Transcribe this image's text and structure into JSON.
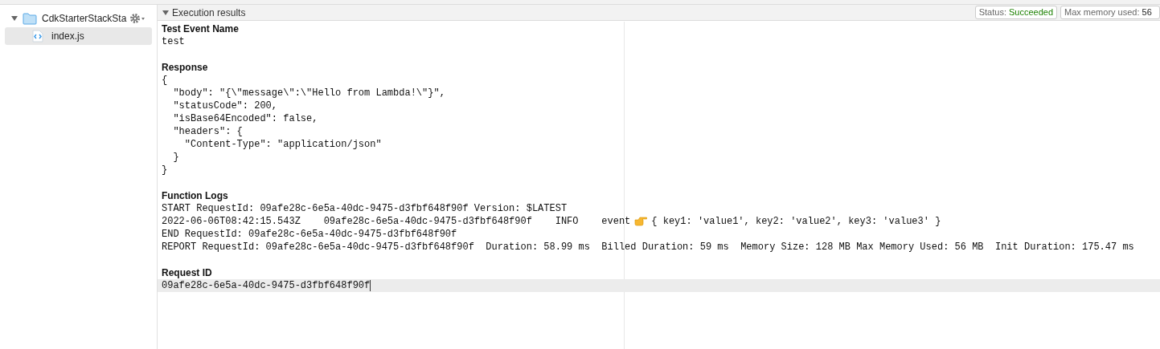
{
  "sidebar": {
    "folder": {
      "name": "CdkStarterStackSta",
      "expanded": true,
      "children": [
        {
          "name": "index.js",
          "selected": true
        }
      ]
    }
  },
  "panel": {
    "title": "Execution results",
    "expanded": true,
    "status_label": "Status:",
    "status_value": "Succeeded",
    "memory_label": "Max memory used:",
    "memory_value": "56"
  },
  "sections": [
    {
      "heading": "Test Event Name",
      "lines": [
        {
          "text": "test"
        }
      ]
    },
    {
      "heading": "Response",
      "lines": [
        {
          "text": "{"
        },
        {
          "text": "  \"body\": \"{\\\"message\\\":\\\"Hello from Lambda!\\\"}\","
        },
        {
          "text": "  \"statusCode\": 200,"
        },
        {
          "text": "  \"isBase64Encoded\": false,"
        },
        {
          "text": "  \"headers\": {"
        },
        {
          "text": "    \"Content-Type\": \"application/json\""
        },
        {
          "text": "  }"
        },
        {
          "text": "}"
        }
      ]
    },
    {
      "heading": "Function Logs",
      "lines": [
        {
          "text": "START RequestId: 09afe28c-6e5a-40dc-9475-d3fbf648f90f Version: $LATEST"
        },
        {
          "text": "2022-06-06T08:42:15.543Z\t09afe28c-6e5a-40dc-9475-d3fbf648f90f\tINFO\tevent",
          "after_icon": "{ key1: 'value1', key2: 'value2', key3: 'value3' }"
        },
        {
          "text": "END RequestId: 09afe28c-6e5a-40dc-9475-d3fbf648f90f"
        },
        {
          "text": "REPORT RequestId: 09afe28c-6e5a-40dc-9475-d3fbf648f90f\tDuration: 58.99 ms\tBilled Duration: 59 ms\tMemory Size: 128 MB\tMax Memory Used: 56 MB\tInit Duration: 175.47 ms"
        }
      ]
    },
    {
      "heading": "Request ID",
      "lines": [
        {
          "text": "09afe28c-6e5a-40dc-9475-d3fbf648f90f",
          "highlighted": true
        }
      ]
    }
  ]
}
